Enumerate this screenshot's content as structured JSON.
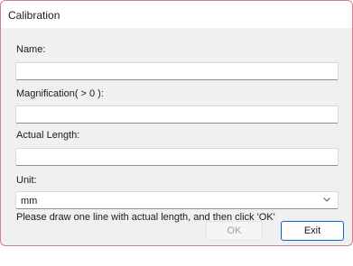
{
  "window": {
    "title": "Calibration"
  },
  "form": {
    "name_label": "Name:",
    "name_value": "",
    "magnification_label": "Magnification( > 0 ):",
    "magnification_value": "",
    "actual_length_label": "Actual Length:",
    "actual_length_value": "",
    "unit_label": "Unit:",
    "unit_selected": "mm",
    "instruction": "Please draw one line with actual length, and then click 'OK'"
  },
  "buttons": {
    "ok": "OK",
    "exit": "Exit"
  },
  "colors": {
    "window_border": "#d77a93",
    "exit_focus_border": "#0c63c6",
    "disabled_text": "#a0a0a0"
  },
  "icons": {
    "unit_dropdown": "chevron-down-icon"
  }
}
